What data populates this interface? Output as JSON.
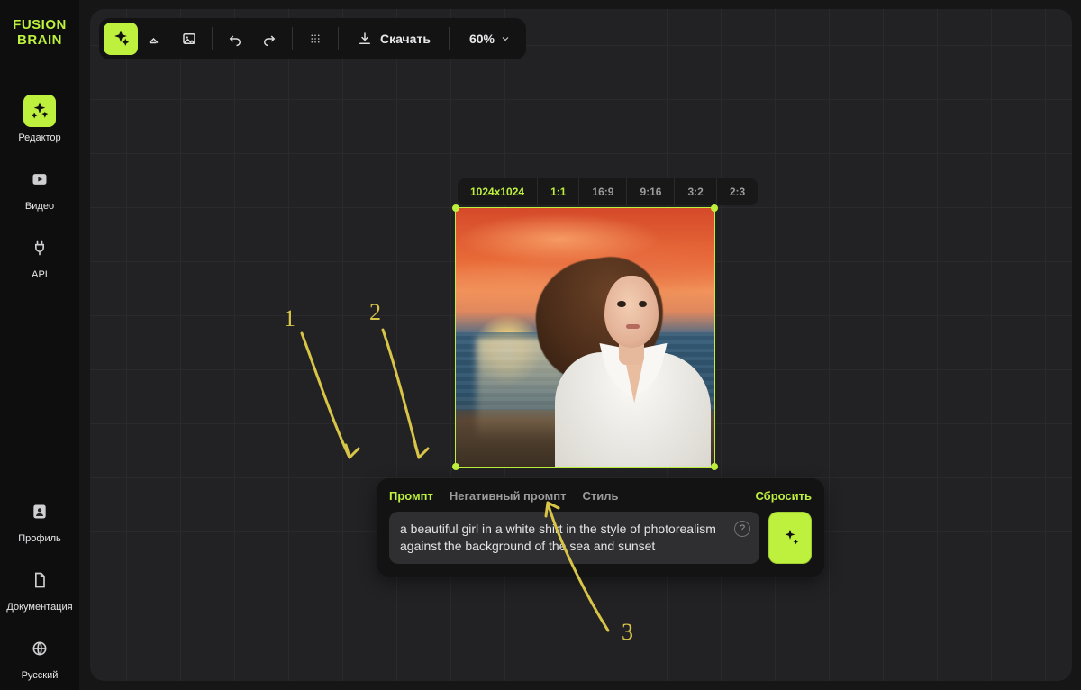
{
  "logo": {
    "line1": "FUSION",
    "line2": "BRAIN"
  },
  "sidebar": {
    "editor": "Редактор",
    "video": "Видео",
    "api": "API",
    "profile": "Профиль",
    "docs": "Документация",
    "lang": "Русский"
  },
  "toolbar": {
    "download": "Скачать",
    "zoom": "60%"
  },
  "ratios": {
    "dim": "1024x1024",
    "r1": "1:1",
    "r2": "16:9",
    "r3": "9:16",
    "r4": "3:2",
    "r5": "2:3"
  },
  "prompt": {
    "tab_prompt": "Промпт",
    "tab_negative": "Негативный промпт",
    "tab_style": "Стиль",
    "reset": "Сбросить",
    "text": "a beautiful girl in a white shirt in the style of photorealism against the background of the sea and sunset"
  },
  "annot": {
    "n1": "1",
    "n2": "2",
    "n3": "3"
  }
}
